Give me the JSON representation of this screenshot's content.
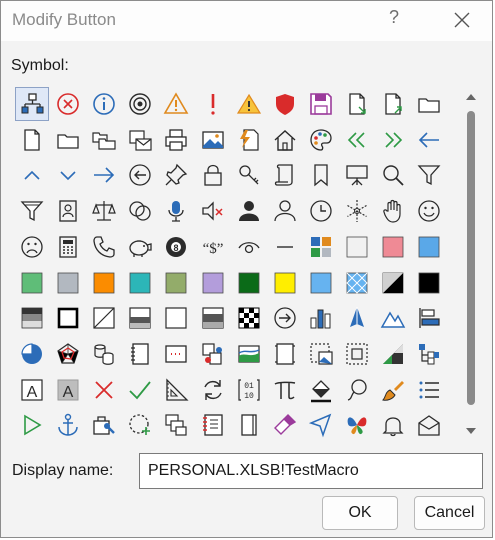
{
  "dialog": {
    "title": "Modify Button",
    "help_label": "?",
    "symbol_label": "Symbol:",
    "display_name_label": "Display name:",
    "display_name_value": "PERSONAL.XLSB!TestMacro",
    "ok_label": "OK",
    "cancel_label": "Cancel"
  },
  "symbols": [
    [
      "org-chart",
      "error-circle",
      "info-circle",
      "target",
      "warning-orange",
      "exclamation-red",
      "warning-small",
      "shield-red",
      "save-purple",
      "document-arrow",
      "document-arrow-up",
      "folder-open"
    ],
    [
      "document",
      "folder",
      "folders-copy",
      "mail-doc",
      "printer",
      "picture",
      "lightning-doc",
      "home",
      "palette",
      "double-arrow-left",
      "double-arrow-right",
      "arrow-left"
    ],
    [
      "chevron-up",
      "chevron-down",
      "arrow-right",
      "back-circle",
      "pin",
      "lock",
      "key",
      "scroll",
      "bookmark",
      "presentation",
      "magnifier",
      "funnel"
    ],
    [
      "funnel-outline",
      "contact-card",
      "scales",
      "circles",
      "microphone",
      "speaker-mute",
      "person-dark",
      "person",
      "clock",
      "snowflake",
      "hand",
      "smiley"
    ],
    [
      "frown",
      "calculator",
      "phone",
      "piggy-bank",
      "eight-ball",
      "dollar-quote",
      "eye",
      "dash",
      "color-tiles",
      "swatch-lightgray",
      "swatch-rose",
      "swatch-blue"
    ],
    [
      "swatch-green",
      "swatch-silver",
      "swatch-orange",
      "swatch-teal",
      "swatch-olive",
      "swatch-lavender",
      "swatch-darkgreen",
      "swatch-yellow",
      "swatch-azure",
      "swatch-pattern",
      "swatch-diagonal-black",
      "swatch-black"
    ],
    [
      "box-gradient",
      "box-outline",
      "box-diagonal",
      "box-half",
      "box-white",
      "box-gray",
      "checker",
      "arrow-right-circle",
      "bar-chart",
      "cone-chart",
      "mountains",
      "align-left"
    ],
    [
      "pie-chart",
      "radar-chart",
      "cylinders",
      "notebook",
      "device-red",
      "tool-pieces",
      "landscape",
      "frame",
      "picture-dashed",
      "screen-dashed",
      "color-picker",
      "flow-shapes"
    ],
    [
      "text-a",
      "text-a-shaded",
      "x-red",
      "check-green",
      "triangle-ruler",
      "refresh",
      "binary",
      "pi",
      "fill-bucket",
      "lasso",
      "paintbrush",
      "list"
    ],
    [
      "play-green",
      "anchor",
      "toolbox",
      "add-dashed",
      "copy-shapes",
      "report-red",
      "book-closed",
      "eraser",
      "cursor-blue",
      "butterfly",
      "bell",
      "envelope-open"
    ]
  ],
  "colors": {
    "accent": "#2c6cb8",
    "selection": "#dfe8f7",
    "error_red": "#d92b2b",
    "warning_orange": "#e08a1e",
    "save_purple": "#9b3b9b",
    "check_green": "#2e9a45",
    "swatches": {
      "lightgray": "#f1f1f1",
      "rose": "#ef8a95",
      "blue": "#5aa8e8",
      "green": "#5fbd78",
      "silver": "#b2b8c0",
      "orange": "#fb8c00",
      "teal": "#2cb6b8",
      "olive": "#93ac6a",
      "lavender": "#b39ddb",
      "darkgreen": "#0b6b18",
      "yellow": "#ffee00",
      "azure": "#66b3f0"
    }
  }
}
